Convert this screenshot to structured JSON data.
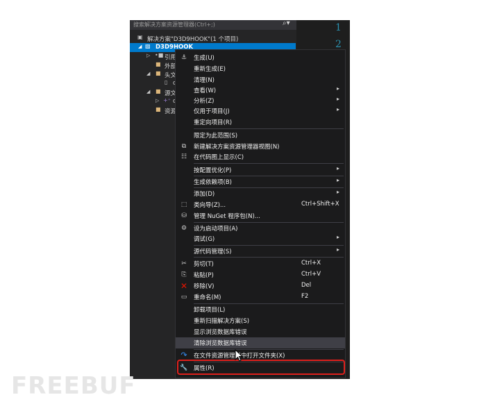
{
  "explorer": {
    "search_placeholder": "搜索解决方案资源管理器(Ctrl+;)",
    "search_icon": "search-icon",
    "solution_label": "解决方案\"D3D9HOOK\"(1 个项目)",
    "project_label": "D3D9HOOK",
    "children": [
      {
        "label": "引用",
        "icon": "reference-icon"
      },
      {
        "label": "外部",
        "icon": "folder-icon"
      },
      {
        "label": "头文",
        "icon": "folder-icon"
      },
      {
        "label": "c",
        "icon": "file-icon"
      },
      {
        "label": "源文",
        "icon": "folder-icon"
      },
      {
        "label": "c",
        "icon": "cpp-file-icon"
      },
      {
        "label": "资源",
        "icon": "folder-icon"
      }
    ]
  },
  "editor": {
    "line_numbers": [
      "1",
      "2"
    ]
  },
  "context_menu": {
    "items": [
      {
        "label": "生成(U)",
        "icon": "build-icon"
      },
      {
        "label": "重新生成(E)"
      },
      {
        "label": "清理(N)"
      },
      {
        "label": "查看(W)",
        "submenu": true
      },
      {
        "label": "分析(Z)",
        "submenu": true
      },
      {
        "label": "仅用于项目(J)",
        "submenu": true
      },
      {
        "label": "重定向项目(R)"
      },
      {
        "label": "限定为此范围(S)"
      },
      {
        "label": "新建解决方案资源管理器视图(N)",
        "icon": "new-view-icon"
      },
      {
        "label": "在代码图上显示(C)",
        "icon": "code-map-icon"
      },
      {
        "label": "按配置优化(P)",
        "submenu": true
      },
      {
        "label": "生成依赖项(B)",
        "submenu": true
      },
      {
        "label": "添加(D)",
        "submenu": true
      },
      {
        "label": "类向导(Z)...",
        "shortcut": "Ctrl+Shift+X",
        "icon": "class-wizard-icon"
      },
      {
        "label": "管理 NuGet 程序包(N)...",
        "icon": "nuget-icon"
      },
      {
        "label": "设为启动项目(A)",
        "icon": "gear-icon"
      },
      {
        "label": "调试(G)",
        "submenu": true
      },
      {
        "label": "源代码管理(S)",
        "submenu": true
      },
      {
        "label": "剪切(T)",
        "shortcut": "Ctrl+X",
        "icon": "scissors-icon"
      },
      {
        "label": "粘贴(P)",
        "shortcut": "Ctrl+V",
        "icon": "paste-icon"
      },
      {
        "label": "移除(V)",
        "shortcut": "Del",
        "icon": "remove-icon"
      },
      {
        "label": "重命名(M)",
        "shortcut": "F2",
        "icon": "rename-icon"
      },
      {
        "label": "卸载项目(L)"
      },
      {
        "label": "重新扫描解决方案(S)"
      },
      {
        "label": "显示浏览数据库错误"
      },
      {
        "label": "清除浏览数据库错误"
      },
      {
        "label": "在文件资源管理器中打开文件夹(X)",
        "icon": "open-folder-icon"
      },
      {
        "label": "属性(R)",
        "icon": "wrench-icon"
      }
    ]
  },
  "watermark": "FREEBUF",
  "colors": {
    "accent": "#007acc",
    "highlight_border": "#e0201c",
    "menu_bg": "#1b1b1c",
    "remove_icon": "#e51400"
  }
}
